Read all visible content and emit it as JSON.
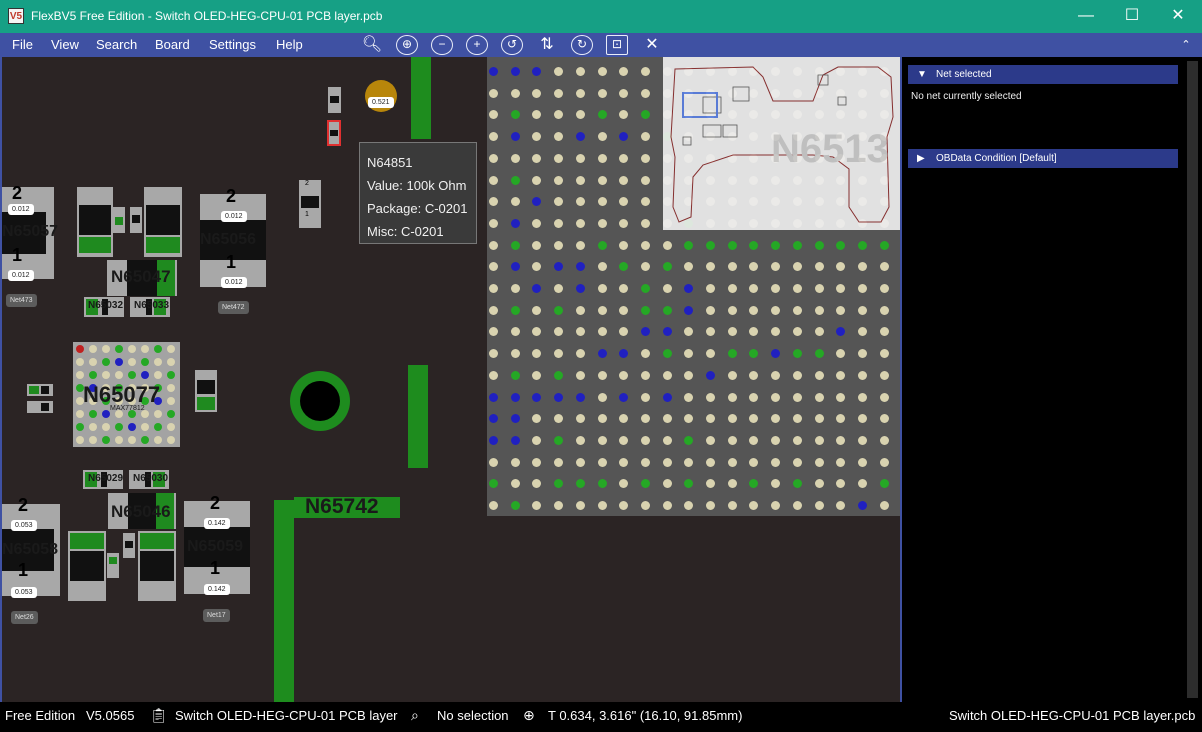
{
  "window": {
    "title": "FlexBV5 Free Edition - Switch OLED-HEG-CPU-01 PCB layer.pcb",
    "minimize": "—",
    "maximize": "☐",
    "close": "✕"
  },
  "menu": {
    "items": [
      "File",
      "View",
      "Search",
      "Board",
      "Settings",
      "Help"
    ],
    "tools": [
      "zoom-fit-icon",
      "zoom-in-icon",
      "zoom-out-icon",
      "zoom-plus-icon",
      "rotate-left-icon",
      "flip-icon",
      "rotate-right-icon",
      "fit-view-icon",
      "close-icon"
    ]
  },
  "board": {
    "tooltip": {
      "name": "N64851",
      "value": "Value: 100k Ohm",
      "package": "Package: C-0201",
      "misc": "Misc: C-0201"
    },
    "labels": {
      "n65057": "N65057",
      "n65056": "N65056",
      "n65047": "N65047",
      "n65032": "N65032",
      "n65033": "N65033",
      "n65077": "N65077",
      "max77812": "MAX77812",
      "n65029": "N65029",
      "n65030": "N65030",
      "n65046": "N65046",
      "n65058": "N65058",
      "n65059": "N65059",
      "n65742": "N65742",
      "n6513": "N6513"
    },
    "values": {
      "v521": "0.521",
      "v012": "0.012",
      "v053": "0.053",
      "v142": "0.142"
    },
    "nets": {
      "net473": "Net473",
      "net472": "Net472",
      "net26": "Net26",
      "net17": "Net17"
    },
    "pins": {
      "p2": "2",
      "p1": "1"
    }
  },
  "panel": {
    "net_selected_header": "Net selected",
    "net_selected_body": "No net currently selected",
    "obdata_header": "OBData Condition [Default]"
  },
  "status": {
    "edition": "Free Edition",
    "version": "V5.0565",
    "layer": "Switch OLED-HEG-CPU-01 PCB layer",
    "selection": "No selection",
    "coords": "T 0.634, 3.616\" (16.10, 91.85mm)",
    "file": "Switch OLED-HEG-CPU-01 PCB layer.pcb"
  },
  "colors": {
    "titlebar": "#16a085",
    "menubar": "#3f51a3",
    "board_bg": "#2b2424",
    "bga_bg": "#555555",
    "pad_green": "#1f8a1f",
    "dot_beige": "#d9d3b0",
    "dot_blue": "#2020c0",
    "dot_green": "#25a825"
  }
}
